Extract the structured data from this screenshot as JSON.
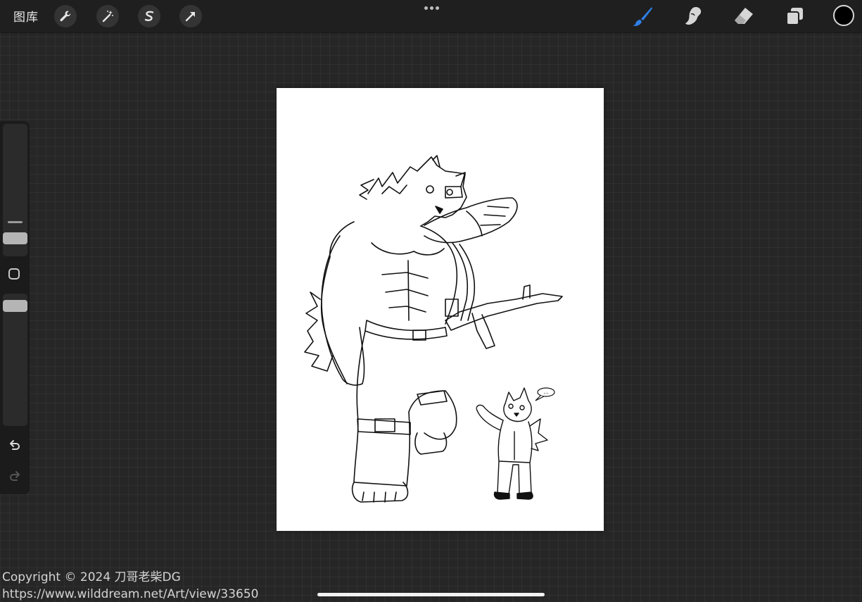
{
  "topbar": {
    "gallery_label": "图库",
    "left_tools": [
      {
        "name": "actions",
        "icon": "wrench-icon"
      },
      {
        "name": "adjustments",
        "icon": "magic-wand-icon"
      },
      {
        "name": "selection",
        "icon": "selection-s-icon"
      },
      {
        "name": "transform",
        "icon": "arrow-cursor-icon"
      }
    ],
    "more_icon": "ellipsis-icon",
    "right_tools": [
      {
        "name": "brush",
        "icon": "brush-icon",
        "active": true
      },
      {
        "name": "smudge",
        "icon": "smudge-finger-icon",
        "active": false
      },
      {
        "name": "eraser",
        "icon": "eraser-icon",
        "active": false
      },
      {
        "name": "layers",
        "icon": "layers-icon",
        "active": false
      }
    ],
    "current_color": "#000000"
  },
  "sidebar": {
    "brush_size_level": 0.1,
    "opacity_level": 0.95,
    "modify_icon": "square-outline-icon",
    "undo_icon": "undo-arrow-icon",
    "redo_icon": "redo-arrow-icon"
  },
  "canvas": {
    "background": "#ffffff",
    "speech_bubble_text": "..."
  },
  "footer": {
    "copyright_line1": "Copyright © 2024 刀哥老柴DG",
    "copyright_line2": "https://www.wilddream.net/Art/view/33650"
  },
  "colors": {
    "accent": "#2f7fe8",
    "toolbar_bg": "#1f1f1f",
    "workspace_bg": "#262626"
  }
}
